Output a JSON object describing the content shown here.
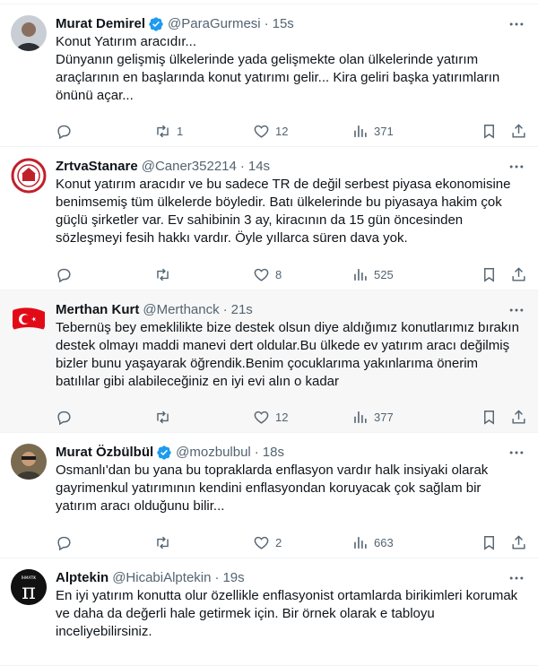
{
  "tweets": [
    {
      "name": "Murat Demirel",
      "handle": "@ParaGurmesi",
      "time": "15s",
      "verified": true,
      "body": "Konut Yatırım aracıdır...\nDünyanın gelişmiş ülkelerinde yada gelişmekte olan ülkelerinde yatırım araçlarının en başlarında konut yatırımı gelir... Kira geliri başka yatırımların önünü açar...",
      "replies": "",
      "retweets": "1",
      "likes": "12",
      "views": "371"
    },
    {
      "name": "ZrtvaStanare",
      "handle": "@Caner352214",
      "time": "14s",
      "verified": false,
      "body": "Konut yatırım aracıdır ve bu sadece TR de değil serbest piyasa ekonomisine benimsemiş tüm ülkelerde böyledir. Batı ülkelerinde bu piyasaya hakim çok güçlü şirketler var. Ev sahibinin 3 ay, kiracının da 15 gün öncesinden sözleşmeyi fesih hakkı vardır. Öyle yıllarca süren dava yok.",
      "replies": "",
      "retweets": "",
      "likes": "8",
      "views": "525"
    },
    {
      "name": "Merthan Kurt",
      "handle": "@Merthanck",
      "time": "21s",
      "verified": false,
      "body": "Tebernüş bey emeklilikte bize destek olsun diye aldığımız konutlarımız bırakın destek olmayı maddi manevi dert oldular.Bu ülkede ev yatırım aracı değilmiş bizler bunu yaşayarak öğrendik.Benim çocuklarıma yakınlarıma önerim batılılar gibi alabileceğiniz en iyi evi alın o kadar",
      "replies": "",
      "retweets": "",
      "likes": "12",
      "views": "377"
    },
    {
      "name": "Murat Özbülbül",
      "handle": "@mozbulbul",
      "time": "18s",
      "verified": true,
      "body": "Osmanlı'dan bu yana bu topraklarda enflasyon vardır halk insiyaki olarak gayrimenkul yatırımının kendini enflasyondan koruyacak çok sağlam bir yatırım aracı olduğunu bilir...",
      "replies": "",
      "retweets": "",
      "likes": "2",
      "views": "663"
    },
    {
      "name": "Alptekin",
      "handle": "@HicabiAlptekin",
      "time": "19s",
      "verified": false,
      "body": "En iyi yatırım konutta olur özellikle enflasyonist ortamlarda birikimleri korumak ve daha da değerli hale getirmek için. Bir örnek olarak e tabloyu inceliyebilirsiniz."
    }
  ],
  "avatar_text": {
    "t4": "π",
    "t4_small": "İHMATİK"
  },
  "colors": {
    "verified": "#1d9bf0",
    "muted": "#536471",
    "border": "#eff3f4"
  },
  "icons": [
    "reply-icon",
    "retweet-icon",
    "like-icon",
    "views-icon",
    "bookmark-icon",
    "share-icon",
    "more-icon",
    "verified-icon"
  ]
}
